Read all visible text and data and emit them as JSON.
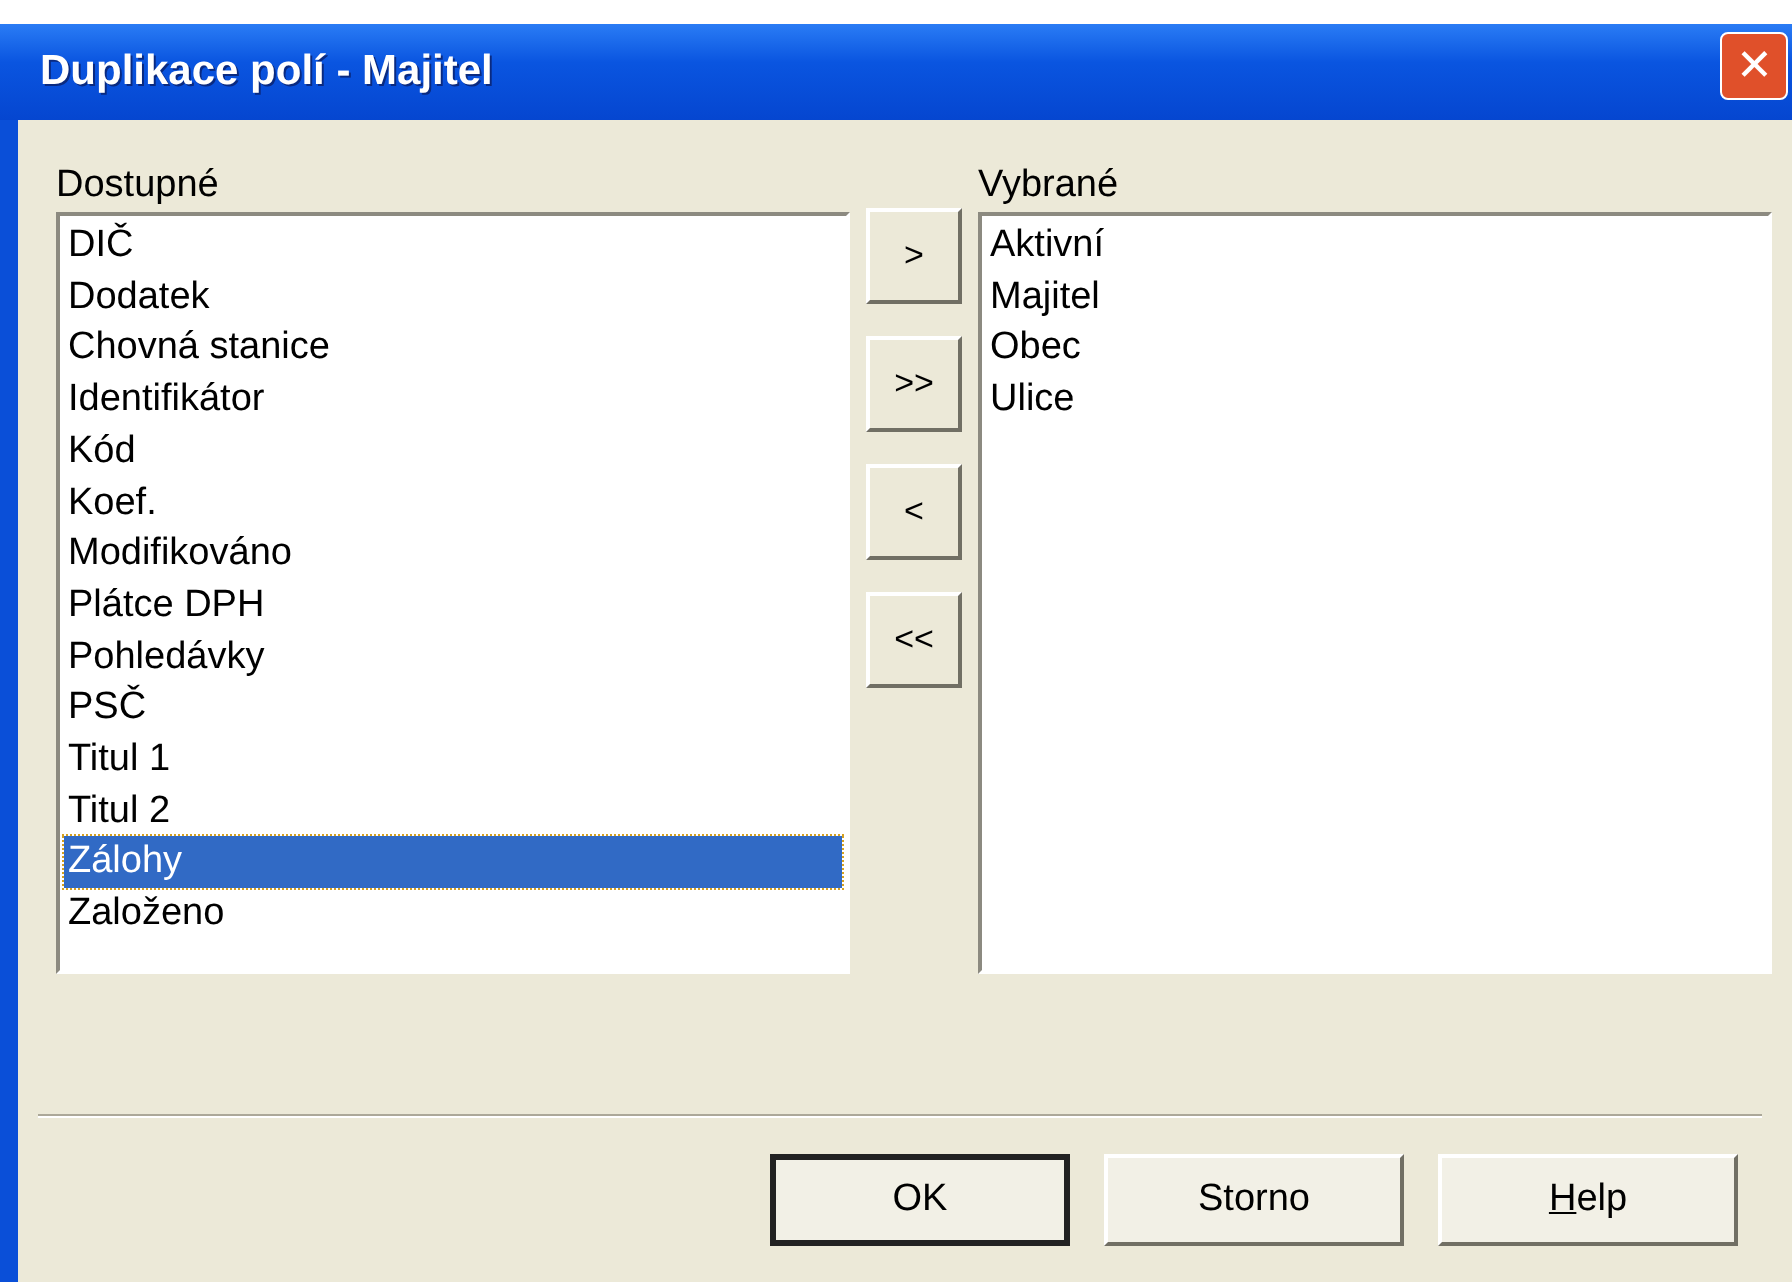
{
  "window": {
    "title": "Duplikace polí - Majitel",
    "close_symbol": "✕"
  },
  "available": {
    "label": "Dostupné",
    "items": [
      {
        "text": "DIČ",
        "selected": false
      },
      {
        "text": "Dodatek",
        "selected": false
      },
      {
        "text": "Chovná stanice",
        "selected": false
      },
      {
        "text": "Identifikátor",
        "selected": false
      },
      {
        "text": "Kód",
        "selected": false
      },
      {
        "text": "Koef.",
        "selected": false
      },
      {
        "text": "Modifikováno",
        "selected": false
      },
      {
        "text": "Plátce DPH",
        "selected": false
      },
      {
        "text": "Pohledávky",
        "selected": false
      },
      {
        "text": "PSČ",
        "selected": false
      },
      {
        "text": "Titul 1",
        "selected": false
      },
      {
        "text": "Titul 2",
        "selected": false
      },
      {
        "text": "Zálohy",
        "selected": true
      },
      {
        "text": "Založeno",
        "selected": false
      }
    ]
  },
  "move_buttons": [
    ">",
    ">>",
    "<",
    "<<"
  ],
  "chosen": {
    "label": "Vybrané",
    "items": [
      {
        "text": "Aktivní",
        "selected": false
      },
      {
        "text": "Majitel",
        "selected": false
      },
      {
        "text": "Obec",
        "selected": false
      },
      {
        "text": "Ulice",
        "selected": false
      }
    ]
  },
  "buttons": [
    {
      "label": "OK",
      "default": true,
      "underline_first": false
    },
    {
      "label": "Storno",
      "default": false,
      "underline_first": false
    },
    {
      "label": "Help",
      "default": false,
      "underline_first": true
    }
  ]
}
